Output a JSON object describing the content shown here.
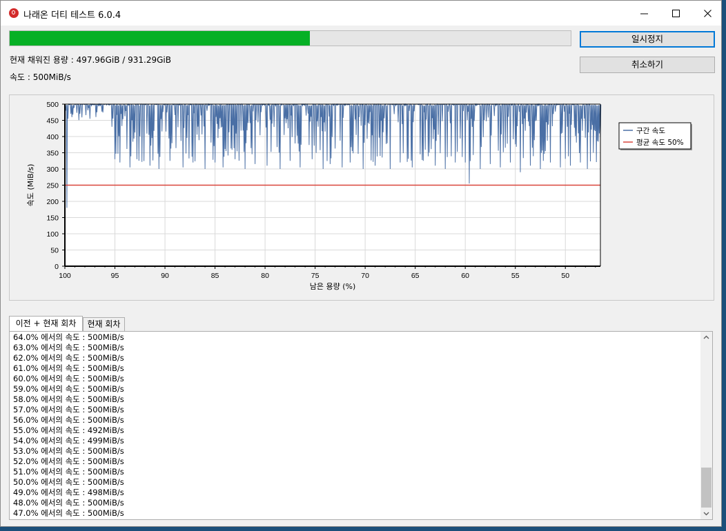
{
  "window": {
    "title": "나래온 더티 테스트 6.0.4"
  },
  "progress": {
    "fraction": 0.5347,
    "color": "#06b025"
  },
  "buttons": {
    "pause_label": "일시정지",
    "cancel_label": "취소하기"
  },
  "status": {
    "filled_text": "현재 채워진 용량 : 497.96GiB / 931.29GiB",
    "speed_text": "속도 : 500MiB/s"
  },
  "chart_data": {
    "type": "line",
    "xlabel": "남은 용량 (%)",
    "ylabel": "속도 (MiB/s)",
    "xlim": [
      100,
      46.5
    ],
    "ylim": [
      0,
      500
    ],
    "x_ticks": [
      "100",
      "95",
      "90",
      "85",
      "80",
      "75",
      "70",
      "65",
      "60",
      "55",
      "50"
    ],
    "y_ticks": [
      "0",
      "50",
      "100",
      "150",
      "200",
      "250",
      "300",
      "350",
      "400",
      "450",
      "500"
    ],
    "grid": true,
    "legend_position": "right",
    "series": [
      {
        "name": "구간 속도",
        "color": "#4a6fa5",
        "baseline": 500,
        "dips": [
          [
            99.8,
            180
          ],
          [
            99.3,
            460
          ],
          [
            98.5,
            470
          ],
          [
            97.5,
            455
          ],
          [
            96.8,
            475
          ],
          [
            95.3,
            430
          ],
          [
            95.0,
            330
          ],
          [
            94.5,
            320
          ],
          [
            93.5,
            305
          ],
          [
            92.8,
            330
          ],
          [
            91.5,
            310
          ],
          [
            90.6,
            300
          ],
          [
            89.5,
            325
          ],
          [
            88.2,
            305
          ],
          [
            87.2,
            320
          ],
          [
            86.0,
            300
          ],
          [
            85.0,
            320
          ],
          [
            84.2,
            305
          ],
          [
            83.0,
            330
          ],
          [
            82.0,
            300
          ],
          [
            81.0,
            315
          ],
          [
            79.8,
            310
          ],
          [
            78.5,
            300
          ],
          [
            77.5,
            325
          ],
          [
            76.5,
            305
          ],
          [
            75.3,
            330
          ],
          [
            74.2,
            300
          ],
          [
            73.5,
            315
          ],
          [
            72.3,
            305
          ],
          [
            71.5,
            320
          ],
          [
            70.2,
            300
          ],
          [
            69.0,
            310
          ],
          [
            67.5,
            300
          ],
          [
            66.5,
            320
          ],
          [
            65.3,
            305
          ],
          [
            64.2,
            325
          ],
          [
            63.0,
            310
          ],
          [
            62.0,
            300
          ],
          [
            61.0,
            320
          ],
          [
            60.0,
            320
          ],
          [
            59.6,
            255
          ],
          [
            58.5,
            300
          ],
          [
            57.5,
            315
          ],
          [
            56.5,
            305
          ],
          [
            55.5,
            320
          ],
          [
            54.5,
            290
          ],
          [
            53.5,
            310
          ],
          [
            52.5,
            300
          ],
          [
            51.5,
            320
          ],
          [
            50.5,
            305
          ],
          [
            49.5,
            310
          ],
          [
            48.5,
            320
          ],
          [
            47.8,
            300
          ],
          [
            47.2,
            350
          ]
        ]
      },
      {
        "name": "평균 속도 50%",
        "color": "#d9443a",
        "value": 250
      }
    ]
  },
  "tabs": [
    {
      "label": "이전 + 현재 회차"
    },
    {
      "label": "현재 회차"
    }
  ],
  "log": [
    "64.0% 에서의 속도 : 500MiB/s",
    "63.0% 에서의 속도 : 500MiB/s",
    "62.0% 에서의 속도 : 500MiB/s",
    "61.0% 에서의 속도 : 500MiB/s",
    "60.0% 에서의 속도 : 500MiB/s",
    "59.0% 에서의 속도 : 500MiB/s",
    "58.0% 에서의 속도 : 500MiB/s",
    "57.0% 에서의 속도 : 500MiB/s",
    "56.0% 에서의 속도 : 500MiB/s",
    "55.0% 에서의 속도 : 492MiB/s",
    "54.0% 에서의 속도 : 499MiB/s",
    "53.0% 에서의 속도 : 500MiB/s",
    "52.0% 에서의 속도 : 500MiB/s",
    "51.0% 에서의 속도 : 500MiB/s",
    "50.0% 에서의 속도 : 500MiB/s",
    "49.0% 에서의 속도 : 498MiB/s",
    "48.0% 에서의 속도 : 500MiB/s",
    "47.0% 에서의 속도 : 500MiB/s"
  ],
  "icons": {
    "app": "app-logo-icon",
    "minimize": "minimize-icon",
    "maximize": "maximize-icon",
    "close": "close-icon",
    "scroll_up": "chevron-up-icon",
    "scroll_down": "chevron-down-icon"
  }
}
